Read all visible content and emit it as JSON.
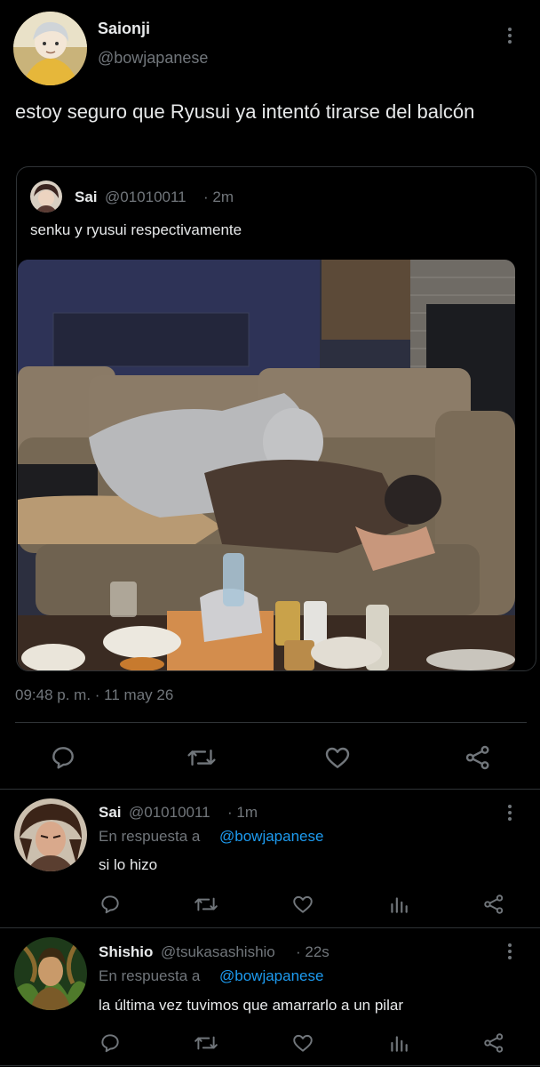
{
  "main_tweet": {
    "author_name": "Saionji",
    "author_handle": "@bowjapanese",
    "text": "estoy seguro que Ryusui ya intentó tirarse del balcón",
    "timestamp": "09:48 p. m. · 11 may 26"
  },
  "quoted_tweet": {
    "author_name": "Sai",
    "author_handle": "@01010011",
    "time": "· 2m",
    "text": "senku y ryusui respectivamente",
    "image_icon": "photo-two-people-lying-on-couch"
  },
  "actions": {
    "icons": [
      "reply-icon",
      "retweet-icon",
      "like-icon",
      "share-icon"
    ]
  },
  "replies": [
    {
      "author_name": "Sai",
      "author_handle": "@01010011",
      "time": "· 1m",
      "reply_prefix": "En respuesta a",
      "reply_to": "@bowjapanese",
      "text": "si lo hizo"
    },
    {
      "author_name": "Shishio",
      "author_handle": "@tsukasashishio",
      "time": "· 22s",
      "reply_prefix": "En respuesta a",
      "reply_to": "@bowjapanese",
      "text": "la última vez tuvimos que amarrarlo a un pilar"
    }
  ],
  "colors": {
    "background": "#000000",
    "text": "#e7e9ea",
    "secondary": "#71767b",
    "link": "#1d9bf0",
    "border": "#2f3336"
  }
}
